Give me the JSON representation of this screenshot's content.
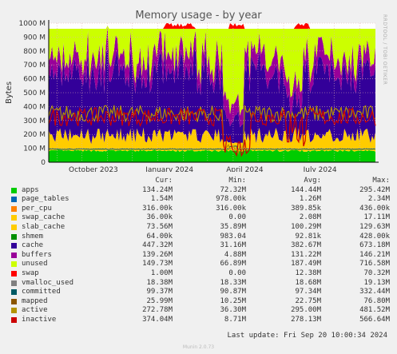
{
  "chart_data": {
    "type": "area",
    "title": "Memory usage - by year",
    "ylabel": "Bytes",
    "side_label": "RRDTOOL / TOBI OETIKER",
    "y_unit": "M",
    "ylim": [
      0,
      1000
    ],
    "y_ticks": [
      "0",
      "100 M",
      "200 M",
      "300 M",
      "400 M",
      "500 M",
      "600 M",
      "700 M",
      "800 M",
      "900 M",
      "1000 M"
    ],
    "x_ticks": [
      "October 2023",
      "January 2024",
      "April 2024",
      "July 2024"
    ],
    "x_start": "2023-08-22",
    "x_end": "2024-09-20",
    "grid": true,
    "legend_header": {
      "cur": "Cur:",
      "min": "Min:",
      "avg": "Avg:",
      "max": "Max:"
    },
    "series": [
      {
        "name": "apps",
        "color": "#00cc00",
        "cur": "134.24M",
        "min": "72.32M",
        "avg": "144.44M",
        "max": "295.42M"
      },
      {
        "name": "page_tables",
        "color": "#0066b3",
        "cur": "1.54M",
        "min": "978.00k",
        "avg": "1.26M",
        "max": "2.34M"
      },
      {
        "name": "per_cpu",
        "color": "#ff8000",
        "cur": "316.00k",
        "min": "316.00k",
        "avg": "389.85k",
        "max": "436.00k"
      },
      {
        "name": "swap_cache",
        "color": "#ffcc00",
        "cur": "36.00k",
        "min": "0.00",
        "avg": "2.08M",
        "max": "17.11M"
      },
      {
        "name": "slab_cache",
        "color": "#ffcc00",
        "cur": "73.56M",
        "min": "35.89M",
        "avg": "100.29M",
        "max": "129.63M"
      },
      {
        "name": "shmem",
        "color": "#008f00",
        "cur": "64.00k",
        "min": "983.04",
        "avg": "92.81k",
        "max": "428.00k"
      },
      {
        "name": "cache",
        "color": "#330099",
        "cur": "447.32M",
        "min": "31.16M",
        "avg": "382.67M",
        "max": "673.18M"
      },
      {
        "name": "buffers",
        "color": "#990099",
        "cur": "139.26M",
        "min": "4.88M",
        "avg": "131.22M",
        "max": "146.21M"
      },
      {
        "name": "unused",
        "color": "#ccff00",
        "cur": "149.73M",
        "min": "66.89M",
        "avg": "187.49M",
        "max": "716.58M"
      },
      {
        "name": "swap",
        "color": "#ff0000",
        "cur": "1.00M",
        "min": "0.00",
        "avg": "12.38M",
        "max": "70.32M"
      },
      {
        "name": "vmalloc_used",
        "color": "#808080",
        "cur": "18.38M",
        "min": "18.33M",
        "avg": "18.68M",
        "max": "19.13M"
      },
      {
        "name": "committed",
        "color": "#005a64",
        "cur": "99.37M",
        "min": "90.87M",
        "avg": "97.34M",
        "max": "332.44M"
      },
      {
        "name": "mapped",
        "color": "#8a5500",
        "cur": "25.99M",
        "min": "10.25M",
        "avg": "22.75M",
        "max": "76.80M"
      },
      {
        "name": "active",
        "color": "#b39300",
        "cur": "272.78M",
        "min": "36.30M",
        "avg": "295.00M",
        "max": "481.52M"
      },
      {
        "name": "inactive",
        "color": "#cc0000",
        "cur": "374.04M",
        "min": "8.71M",
        "avg": "278.13M",
        "max": "566.64M"
      }
    ]
  },
  "last_update": "Last update: Fri Sep 20 10:00:34 2024",
  "footer": "Munin 2.0.73"
}
